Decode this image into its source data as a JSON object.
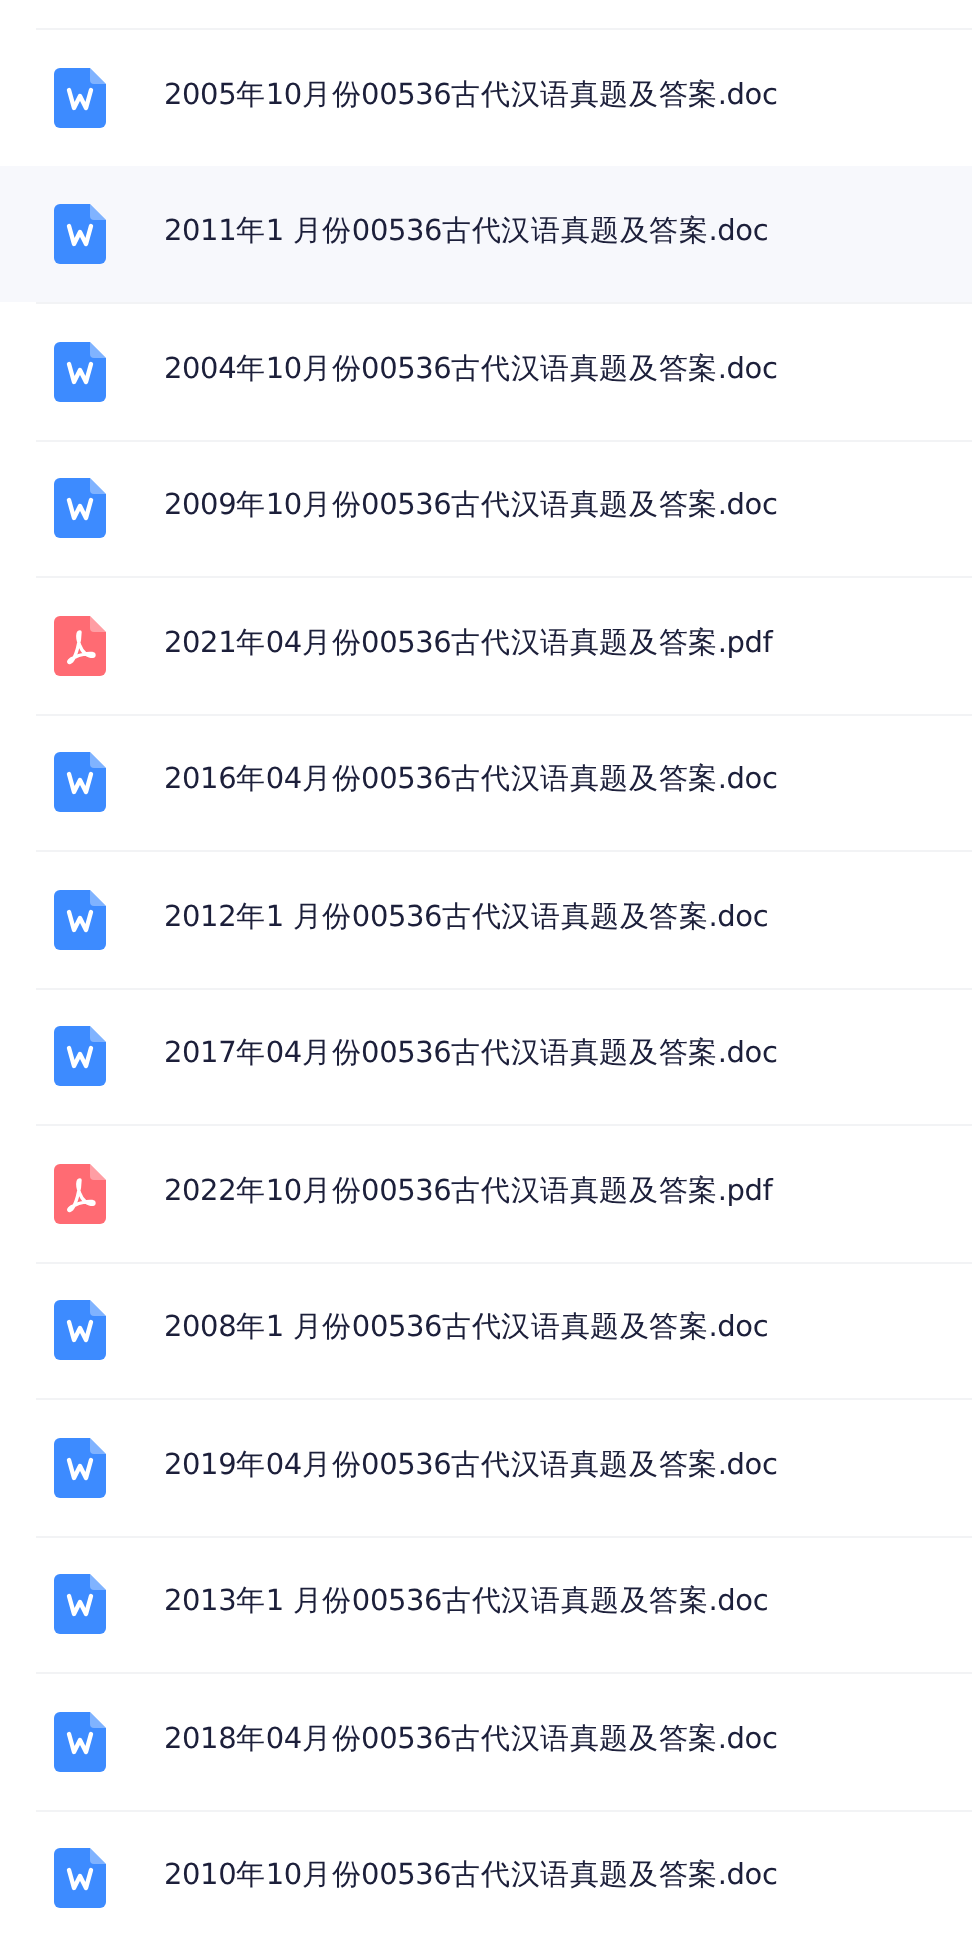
{
  "files": [
    {
      "name": "2005年10月份00536古代汉语真题及答案.doc",
      "kind": "doc",
      "selected": false
    },
    {
      "name": "2011年1 月份00536古代汉语真题及答案.doc",
      "kind": "doc",
      "selected": true
    },
    {
      "name": "2004年10月份00536古代汉语真题及答案.doc",
      "kind": "doc",
      "selected": false
    },
    {
      "name": "2009年10月份00536古代汉语真题及答案.doc",
      "kind": "doc",
      "selected": false
    },
    {
      "name": "2021年04月份00536古代汉语真题及答案.pdf",
      "kind": "pdf",
      "selected": false
    },
    {
      "name": "2016年04月份00536古代汉语真题及答案.doc",
      "kind": "doc",
      "selected": false
    },
    {
      "name": "2012年1 月份00536古代汉语真题及答案.doc",
      "kind": "doc",
      "selected": false
    },
    {
      "name": "2017年04月份00536古代汉语真题及答案.doc",
      "kind": "doc",
      "selected": false
    },
    {
      "name": "2022年10月份00536古代汉语真题及答案.pdf",
      "kind": "pdf",
      "selected": false
    },
    {
      "name": "2008年1 月份00536古代汉语真题及答案.doc",
      "kind": "doc",
      "selected": false
    },
    {
      "name": "2019年04月份00536古代汉语真题及答案.doc",
      "kind": "doc",
      "selected": false
    },
    {
      "name": "2013年1 月份00536古代汉语真题及答案.doc",
      "kind": "doc",
      "selected": false
    },
    {
      "name": "2018年04月份00536古代汉语真题及答案.doc",
      "kind": "doc",
      "selected": false
    },
    {
      "name": "2010年10月份00536古代汉语真题及答案.doc",
      "kind": "doc",
      "selected": false
    }
  ]
}
